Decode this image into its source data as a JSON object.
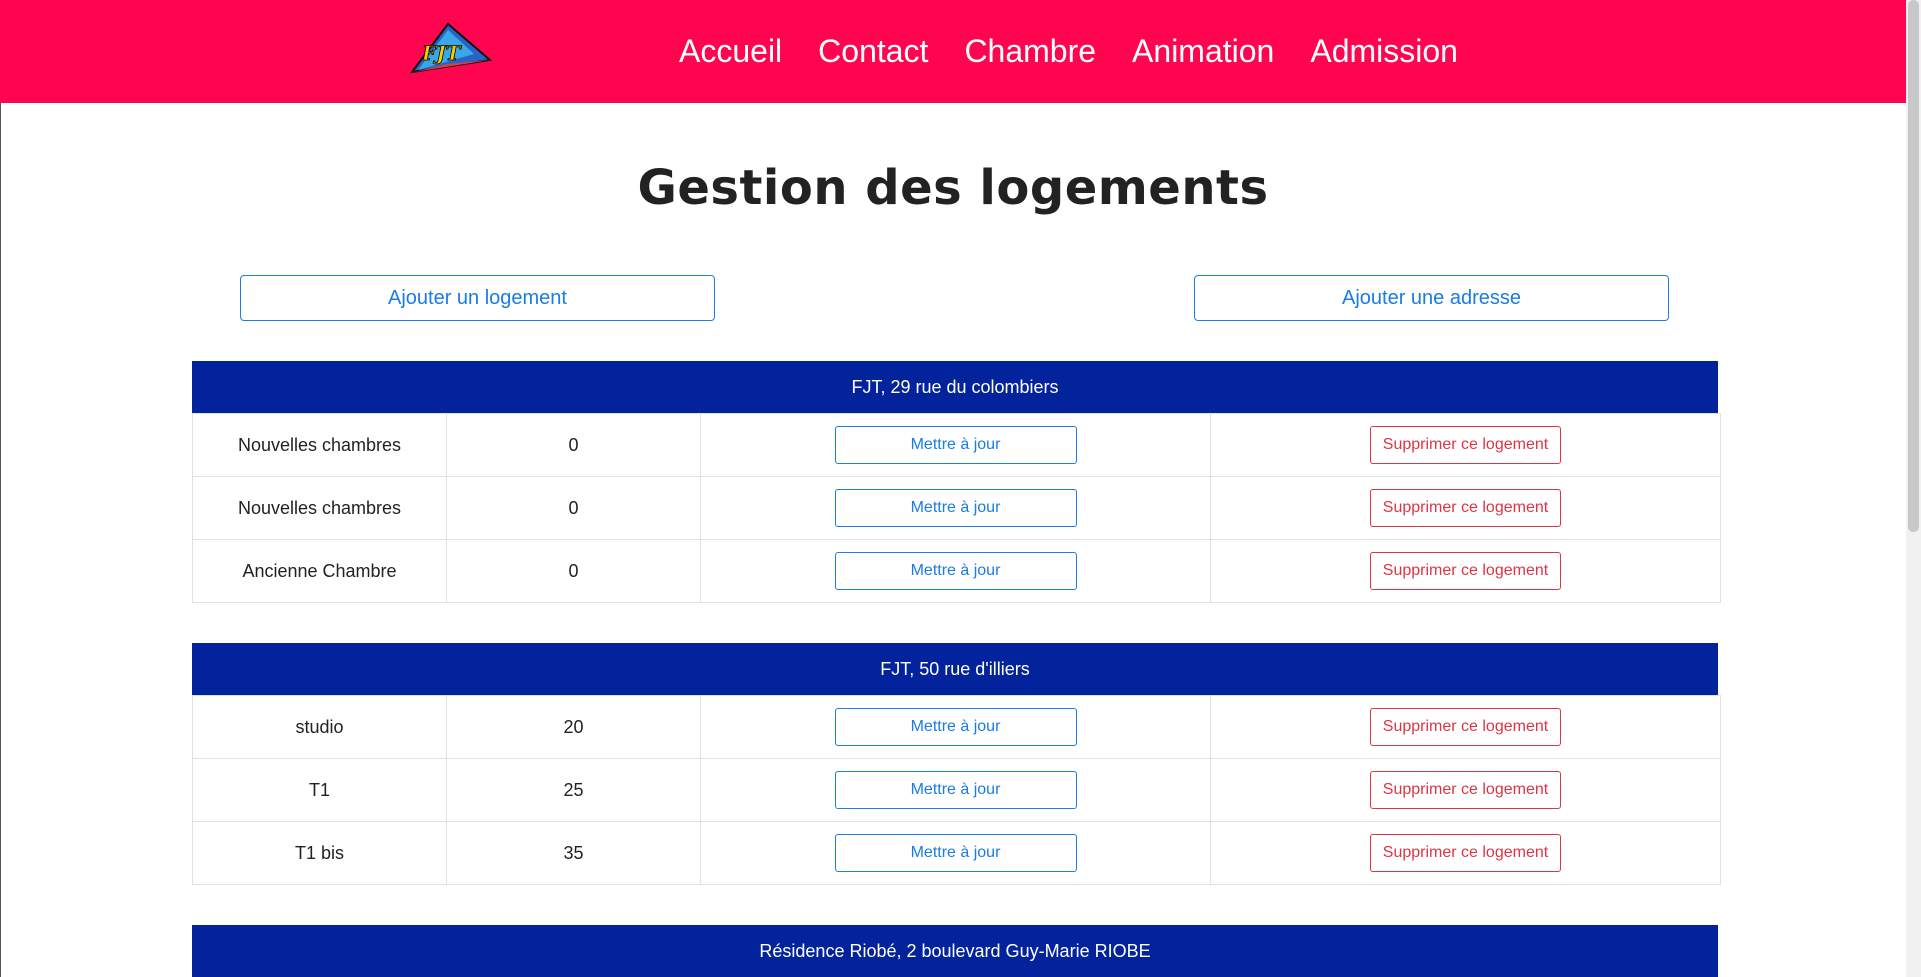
{
  "nav": {
    "items": [
      "Accueil",
      "Contact",
      "Chambre",
      "Animation",
      "Admission"
    ],
    "logo_text": "FJT"
  },
  "page": {
    "title": "Gestion des logements",
    "add_housing_label": "Ajouter un logement",
    "add_address_label": "Ajouter une adresse"
  },
  "row_actions": {
    "update_label": "Mettre à jour",
    "delete_label": "Supprimer ce logement"
  },
  "sections": [
    {
      "title": "FJT, 29 rue du colombiers",
      "rows": [
        {
          "name": "Nouvelles chambres",
          "value": "0"
        },
        {
          "name": "Nouvelles chambres",
          "value": "0"
        },
        {
          "name": "Ancienne Chambre",
          "value": "0"
        }
      ]
    },
    {
      "title": "FJT, 50 rue d'illiers",
      "rows": [
        {
          "name": "studio",
          "value": "20"
        },
        {
          "name": "T1",
          "value": "25"
        },
        {
          "name": "T1 bis",
          "value": "35"
        }
      ]
    },
    {
      "title": "Résidence Riobé, 2 boulevard Guy-Marie RIOBE",
      "rows": []
    }
  ],
  "colors": {
    "navbar": "#ff0550",
    "section_header": "#02239b",
    "primary": "#1a7ce6",
    "danger": "#dc3545"
  }
}
